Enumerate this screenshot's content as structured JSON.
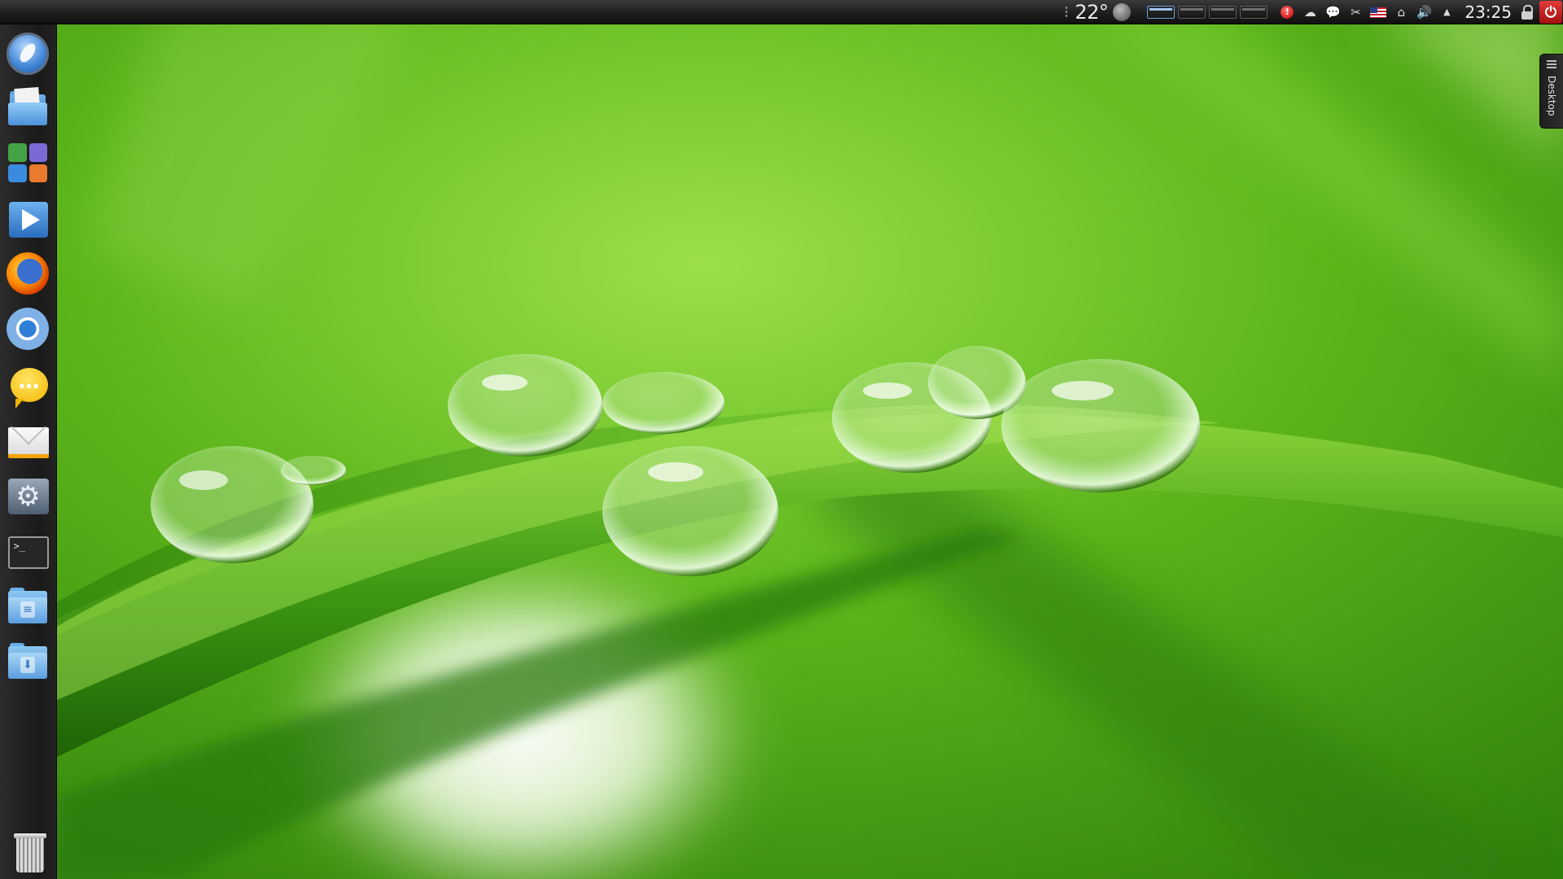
{
  "panel": {
    "weather": {
      "temperature": "22°",
      "condition_icon": "moon-icon"
    },
    "pager": {
      "desktops": 4,
      "active_index": 0
    },
    "tray_icons": [
      "alert-icon",
      "cloud-icon",
      "chat-icon",
      "scissors-icon",
      "us-flag-icon",
      "network-icon",
      "volume-icon",
      "expand-arrow-icon"
    ],
    "clock": "23:25",
    "power_color": "#d32323"
  },
  "dock": {
    "launchers": [
      "kde-menu-icon",
      "file-manager-icon",
      "office-suite-icon",
      "media-player-icon",
      "firefox-icon",
      "chromium-icon",
      "messenger-icon",
      "mail-icon",
      "system-settings-icon",
      "terminal-icon",
      "documents-folder-icon",
      "downloads-folder-icon"
    ],
    "trash": "trash-icon"
  },
  "toolbox": {
    "label": "Desktop"
  },
  "colors": {
    "wallpaper_green": "#5fb61c",
    "accent_blue": "#3f84d6"
  }
}
